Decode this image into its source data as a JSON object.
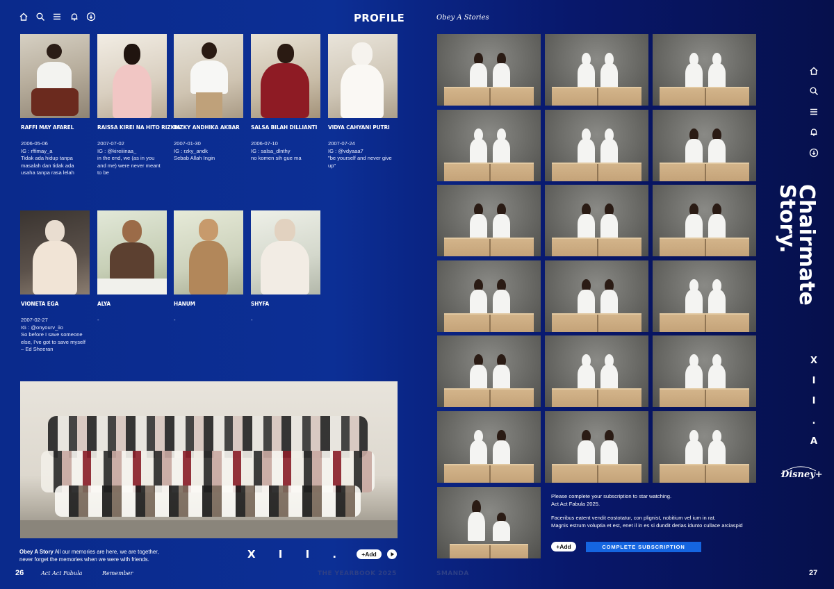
{
  "header": {
    "title": "PROFILE",
    "brand": "Obey A Stories",
    "left_icons": [
      "home-icon",
      "search-icon",
      "menu-icon",
      "bell-icon",
      "download-icon"
    ],
    "right_icons": [
      "home-icon",
      "search-icon",
      "menu-icon",
      "bell-icon",
      "download-icon"
    ]
  },
  "profiles_row1": [
    {
      "name": "RAFFI MAY AFAREL",
      "date": "2006-05-06",
      "ig": "IG : rffimay_a",
      "quote": "Tidak ada hidup tanpa\nmasalah dan tidak ada\nusaha tanpa rasa lelah"
    },
    {
      "name": "RAISSA KIREI NA HITO RIZKIA",
      "date": "2007-07-02",
      "ig": "IG : @kireiiinaa_",
      "quote": "in the end, we (as in you\nand me) were never meant\nto be"
    },
    {
      "name": "RIZKY ANDHIKA AKBAR",
      "date": "2007-01-30",
      "ig": "IG : rzky_andk",
      "quote": "Sebab Allah Ingin"
    },
    {
      "name": "SALSA BILAH DILLIANTI",
      "date": "2006-07-10",
      "ig": "IG : salsa_dlnthy",
      "quote": "no komen sih gue ma"
    },
    {
      "name": "VIDYA CAHYANI PUTRI",
      "date": "2007-07-24",
      "ig": "IG : @vdyaaa7",
      "quote": "\"be yourself and never give\nup\""
    }
  ],
  "profiles_row2": [
    {
      "name": "VIONETA EGA",
      "date": "2007-02-27",
      "ig": "IG : @onyourv_iio",
      "quote": "So before I save someone\nelse, I've got to save myself\n– Ed Sheeran"
    },
    {
      "name": "ALYA",
      "date": "-",
      "ig": "",
      "quote": ""
    },
    {
      "name": "HANUM",
      "date": "-",
      "ig": "",
      "quote": ""
    },
    {
      "name": "SHYFA",
      "date": "-",
      "ig": "",
      "quote": ""
    }
  ],
  "group": {
    "caption_bold": "Obey A Story",
    "caption_rest": " All our memories are here, we are together,",
    "caption_line2": "never forget the memories when we were with friends.",
    "class_label": "X I I . A",
    "add_label": "+Add",
    "play_icon": "play-icon"
  },
  "right_panel": {
    "vertical_title_line1": "Chairmate",
    "vertical_title_line2": "Story.",
    "vertical_class": "X I I . A",
    "disney_logo": "Disney+",
    "subscription_line1": "Please complete your subscription to star watching.",
    "subscription_line2": "Act Act Fabula 2025.",
    "body_line1": "Faceribus eatent vendit eostotatur, con plignist, nobitium vel ium in rat.",
    "body_line2": "Magnis estrum voluptia et est, enet il in es si dundit derias idunto cullace arciaspid",
    "add_label": "+Add",
    "subscribe_label": "COMPLETE SUBSCRIPTION"
  },
  "footer": {
    "left_page": "26",
    "left_item1": "Act Act Fabula",
    "left_item2": "Remember",
    "center_left": "THE YEARBOOK 2025",
    "center_right": "SMANDA",
    "right_page": "27"
  },
  "colors": {
    "background_left": "#0c2f95",
    "background_right": "#06104c",
    "accent_button": "#1565e0",
    "text": "#ffffff"
  }
}
